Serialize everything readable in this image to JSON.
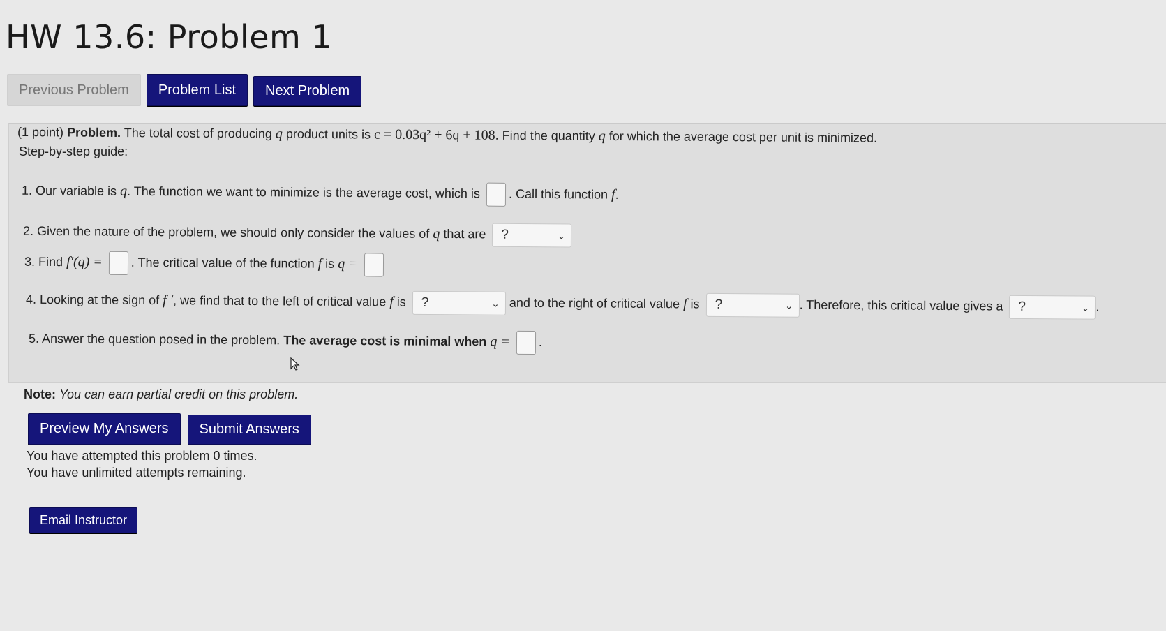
{
  "page": {
    "title": "HW 13.6: Problem 1"
  },
  "nav": {
    "previous_label": "Previous Problem",
    "list_label": "Problem List",
    "next_label": "Next Problem"
  },
  "problem": {
    "points": "(1 point)",
    "heading": "Problem.",
    "text_pre": "The total cost of producing",
    "var_q": "q",
    "text_units": "product units is",
    "equation": "c = 0.03q² + 6q + 108",
    "text_find": ". Find the quantity",
    "text_post": "for which the average cost per unit is minimized.",
    "guide_label": "Step-by-step guide:",
    "step1_a": "1. Our variable is",
    "step1_b": ". The function we want to minimize is the average cost, which is",
    "step1_c": ". Call this function",
    "var_f": "f",
    "step2": "2. Given the nature of the problem, we should only consider the values of",
    "step2_b": "that are",
    "step3_a": "3. Find",
    "step3_fprime": "f′(q) =",
    "step3_b": ". The critical value of the function",
    "step3_c": "is",
    "step3_qeq": "q =",
    "step4_a": "4. Looking at the sign of",
    "step4_fprime": "f ′",
    "step4_b": ", we find that to the left of critical value",
    "step4_is": "is",
    "step4_c": "and to the right of critical value",
    "step4_d": ". Therefore, this critical value gives a",
    "step5_a": "5. Answer the question posed in the problem.",
    "step5_b": "The average cost is minimal when",
    "period": "."
  },
  "selects": {
    "step2_value": "?",
    "step4_left_value": "?",
    "step4_right_value": "?",
    "step4_gives_value": "?"
  },
  "note": {
    "label": "Note:",
    "text": "You can earn partial credit on this problem."
  },
  "actions": {
    "preview_label": "Preview My Answers",
    "submit_label": "Submit Answers"
  },
  "attempts": {
    "line1": "You have attempted this problem 0 times.",
    "line2": "You have unlimited attempts remaining."
  },
  "email": {
    "label": "Email Instructor"
  },
  "colors": {
    "button": "#15157a",
    "background": "#e9e9e9",
    "problem_box": "#dedede"
  }
}
